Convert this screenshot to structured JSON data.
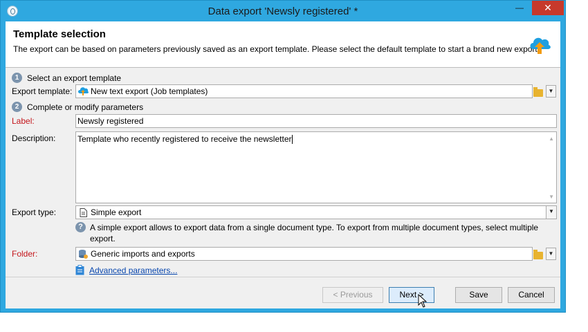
{
  "window": {
    "title": "Data export 'Newsly registered' *",
    "min_glyph": "—",
    "close_glyph": "✕"
  },
  "header": {
    "title": "Template selection",
    "subtitle": "The export can be based on parameters previously saved as an export template. Please select the default template to start a brand new export."
  },
  "steps": [
    {
      "num": "1",
      "label": "Select an export template"
    },
    {
      "num": "2",
      "label": "Complete or modify parameters"
    }
  ],
  "fields": {
    "export_template_label": "Export template:",
    "export_template_value": "New text export (Job templates)",
    "label_label": "Label:",
    "label_value": "Newsly registered",
    "description_label": "Description:",
    "description_value": "Template who recently registered to receive the newsletter",
    "export_type_label": "Export type:",
    "export_type_value": "Simple export",
    "help_text": "A simple export allows to export data from a single document type. To export from multiple document types, select multiple export.",
    "folder_label": "Folder:",
    "folder_value": "Generic imports and exports",
    "advanced_link": "Advanced parameters..."
  },
  "buttons": {
    "previous": "< Previous",
    "next": "Next >",
    "save": "Save",
    "cancel": "Cancel"
  },
  "colors": {
    "titlebar": "#2fa8e0",
    "close": "#c7392b",
    "required_label": "#c4161c",
    "link": "#0645ad"
  }
}
